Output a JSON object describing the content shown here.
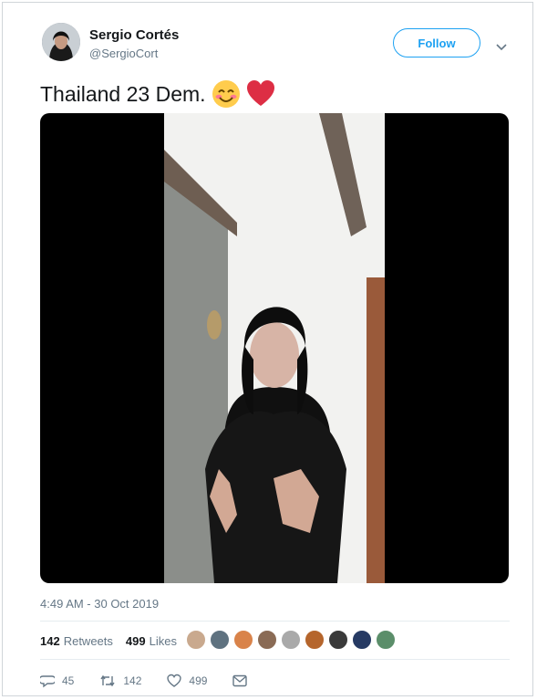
{
  "user": {
    "display_name": "Sergio Cortés",
    "handle": "@SergioCort"
  },
  "follow_label": "Follow",
  "tweet": {
    "text": "Thailand 23 Dem.",
    "emojis": [
      "smiling-face-with-smiling-eyes",
      "red-heart"
    ]
  },
  "timestamp": "4:49 AM - 30 Oct 2019",
  "stats": {
    "retweets_count": "142",
    "retweets_label": "Retweets",
    "likes_count": "499",
    "likes_label": "Likes"
  },
  "likers": [
    "#c9a98e",
    "#5f7280",
    "#d9834a",
    "#8a6b55",
    "#a9a9a9",
    "#b5652c",
    "#3a3a3a",
    "#263a63",
    "#5b8e6a"
  ],
  "actions": {
    "replies": "45",
    "retweets": "142",
    "likes": "499"
  },
  "colors": {
    "accent": "#1da1f2",
    "secondary_text": "#657786",
    "heart": "#e0245e"
  }
}
